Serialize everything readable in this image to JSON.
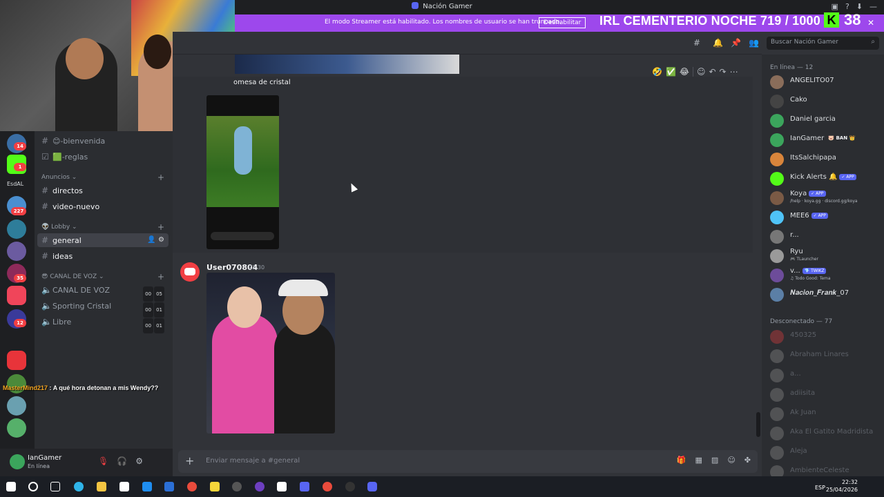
{
  "window": {
    "title": "Nación Gamer"
  },
  "streamer_bar": {
    "message": "El modo Streamer está habilitado. Los nombres de usuario se han truncado.",
    "button": "Deshabilitar"
  },
  "overlay": {
    "title": "IRL CEMENTERIO NOCHE 719 / 1000",
    "kick_logo": "K",
    "kick_count": "38"
  },
  "header": {
    "search_placeholder": "Buscar Nación Gamer"
  },
  "server_rail": {
    "badges": [
      "14",
      "1",
      "227",
      "35",
      "12"
    ],
    "label": "EsdAL"
  },
  "channels": {
    "items_top": [
      {
        "icon": "#",
        "label": "😊-bienvenida"
      },
      {
        "icon": "☑",
        "label": "🟩-reglas"
      }
    ],
    "cat_anuncios": "Anuncios",
    "anuncios": [
      {
        "icon": "#",
        "label": "directos"
      },
      {
        "icon": "#",
        "label": "video-nuevo"
      }
    ],
    "cat_lobby": "👽 Lobby",
    "lobby": [
      {
        "icon": "#",
        "label": "general"
      },
      {
        "icon": "#",
        "label": "ideas"
      }
    ],
    "cat_voz": "😎 CANAL DE VOZ",
    "voice": [
      {
        "label": "CANAL DE VOZ",
        "a": "00",
        "b": "05"
      },
      {
        "label": "Sporting Cristal",
        "a": "00",
        "b": "01"
      },
      {
        "label": "Libre",
        "a": "00",
        "b": "01"
      }
    ]
  },
  "chat_overlay": {
    "user": "MasterMind217",
    "text": " : A qué hora detonan a mis Wendy??"
  },
  "user_panel": {
    "name": "IanGamer",
    "status": "En línea"
  },
  "messages": {
    "reply_snippet": "omesa de cristal",
    "reactions": [
      "🤣",
      "✅",
      "😂"
    ],
    "msg2_user": "User070804",
    "msg2_time": "22:30"
  },
  "composer": {
    "placeholder": "Enviar mensaje a #general"
  },
  "members": {
    "online_header": "En línea — 12",
    "online": [
      {
        "name": "ANGELITO07",
        "color": "#8a6d5a"
      },
      {
        "name": "Cako",
        "color": "#444"
      },
      {
        "name": "Daniel garcia",
        "color": "#3ba55c"
      },
      {
        "name": "IanGamer",
        "color": "#3ba55c",
        "tag": "🐷 BAN 👑"
      },
      {
        "name": "ItsSalchipapa",
        "color": "#d9853b"
      },
      {
        "name": "Kick Alerts",
        "color": "#53fc18",
        "tag": "✓ APP",
        "pre": "🔔"
      },
      {
        "name": "Koya",
        "color": "#7a5a45",
        "tag": "✓ APP",
        "sub": "/help · koya.gg · discord.gg/koya"
      },
      {
        "name": "MEE6",
        "color": "#4fc3f7",
        "tag": "✓ APP"
      },
      {
        "name": "r...",
        "color": "#777"
      },
      {
        "name": "Ryu",
        "color": "#9a9a9a",
        "sub": "🎮 TLauncher"
      },
      {
        "name": "v...",
        "color": "#6d4c9a",
        "tag": "💎 TWIKZ",
        "sub": "♫ Todo Good: Tema"
      },
      {
        "name": "𝑵𝒂𝒄𝒊𝒐𝒏_𝑭𝒓𝒂𝒏𝒌_07",
        "color": "#5b7fa6"
      }
    ],
    "offline_header": "Desconectado — 77",
    "offline": [
      {
        "name": "450325",
        "color": "#f23f43"
      },
      {
        "name": "Abraham Linares",
        "color": "#999"
      },
      {
        "name": "a...",
        "color": "#999"
      },
      {
        "name": "adiisita",
        "color": "#999"
      },
      {
        "name": "Ak Juan",
        "color": "#999"
      },
      {
        "name": "Aka El Gatito Madridista",
        "color": "#999"
      },
      {
        "name": "Aleja",
        "color": "#999"
      },
      {
        "name": "AmbienteCeleste",
        "color": "#999"
      }
    ]
  },
  "taskbar": {
    "time": "22:32",
    "date": "25/04/2026",
    "lang": "ESP"
  }
}
